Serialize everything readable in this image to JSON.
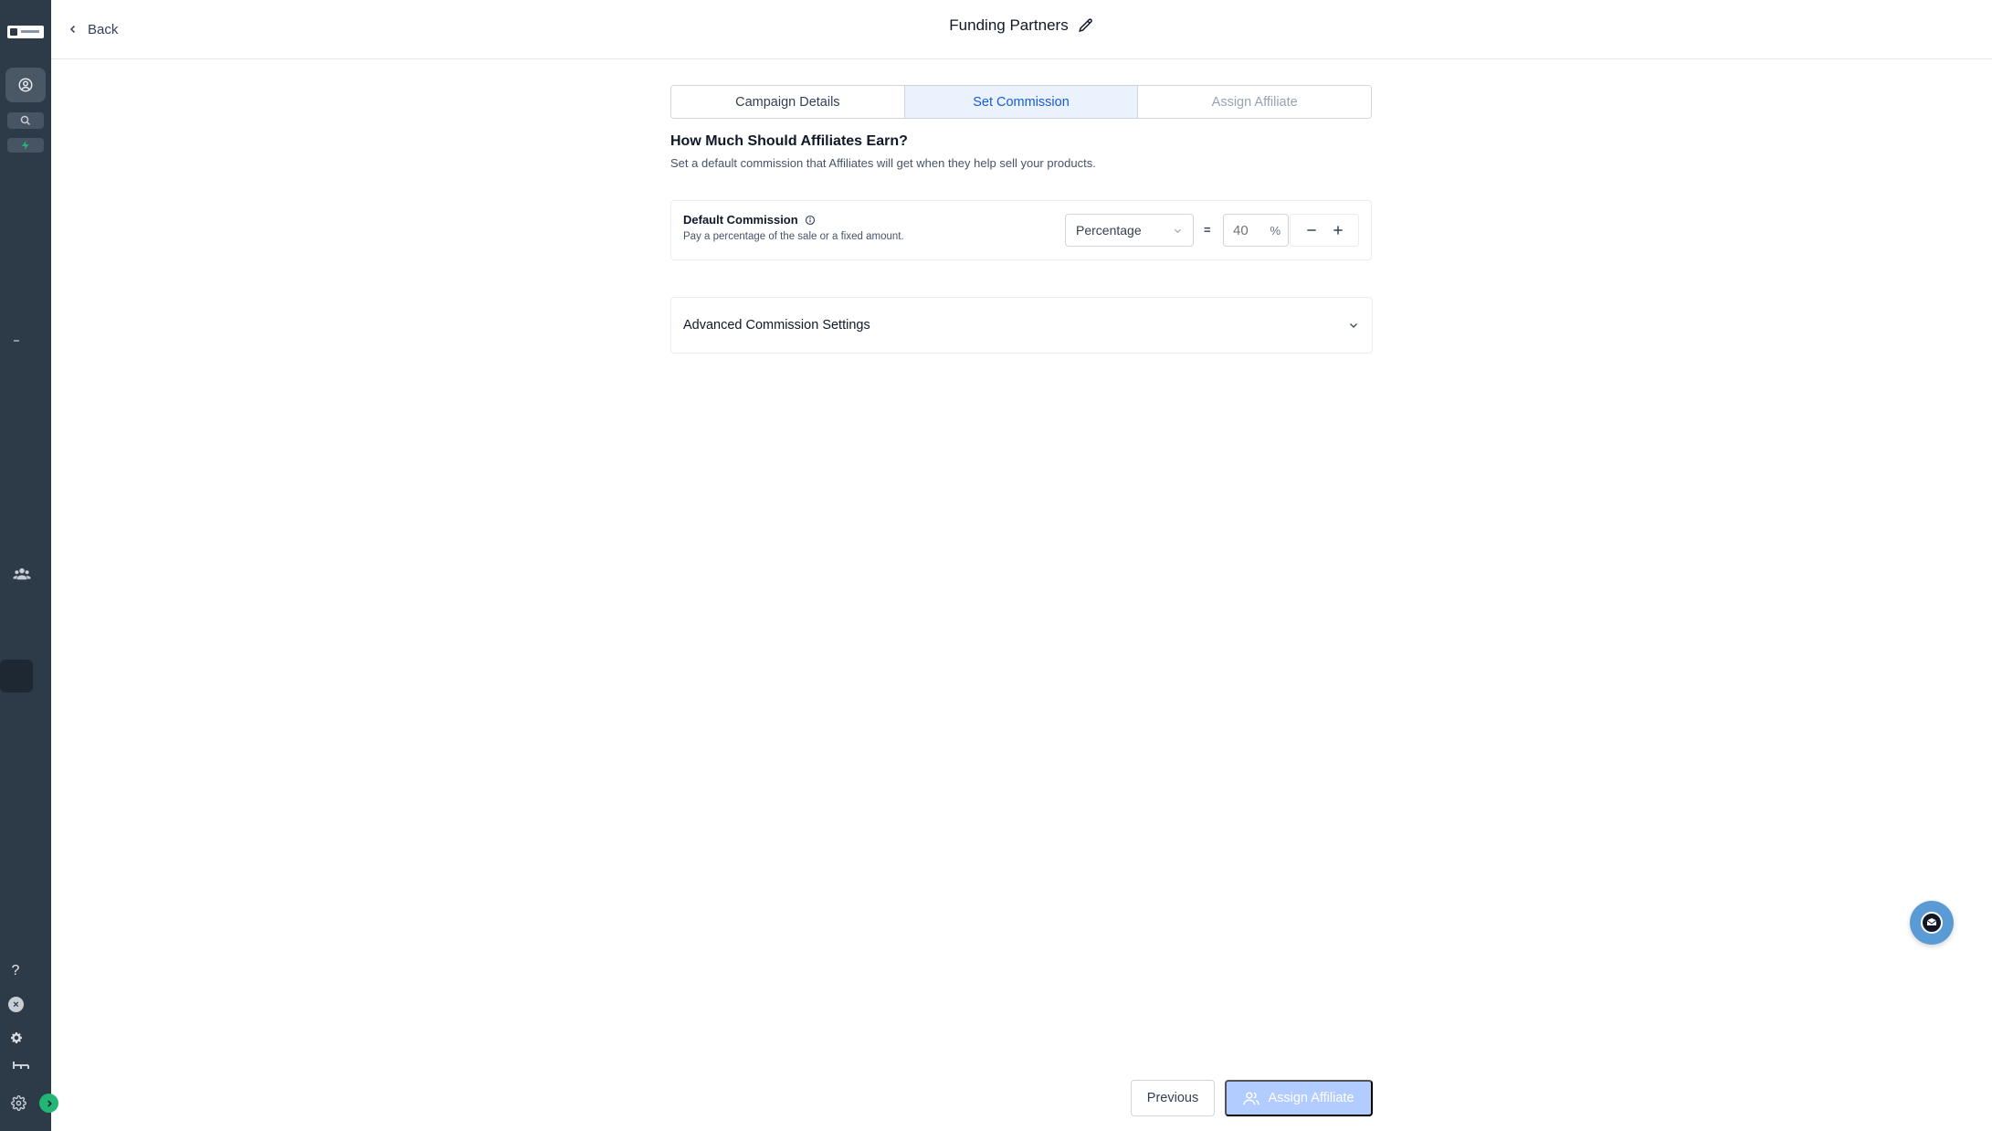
{
  "header": {
    "back_label": "Back",
    "title": "Funding Partners"
  },
  "tabs": [
    {
      "label": "Campaign Details",
      "state": "completed"
    },
    {
      "label": "Set Commission",
      "state": "active"
    },
    {
      "label": "Assign Affiliate",
      "state": "upcoming"
    }
  ],
  "section": {
    "heading": "How Much Should Affiliates Earn?",
    "subheading": "Set a default commission that Affiliates will get when they help sell your products."
  },
  "default_commission": {
    "label": "Default Commission",
    "description": "Pay a percentage of the sale or a fixed amount.",
    "type_selected": "Percentage",
    "equals": "=",
    "amount_placeholder": "40",
    "unit": "%"
  },
  "advanced": {
    "label": "Advanced Commission Settings"
  },
  "footer": {
    "previous_label": "Previous",
    "next_label": "Assign Affiliate"
  },
  "sidebar": {
    "help_label": "?",
    "close_label": "×"
  },
  "colors": {
    "sidebar_bg": "#2d3a47",
    "active_tab_bg": "#eaf2fe",
    "active_tab_text": "#175cd3",
    "disabled_primary": "#b2ccff",
    "accent_green": "#22b573"
  }
}
